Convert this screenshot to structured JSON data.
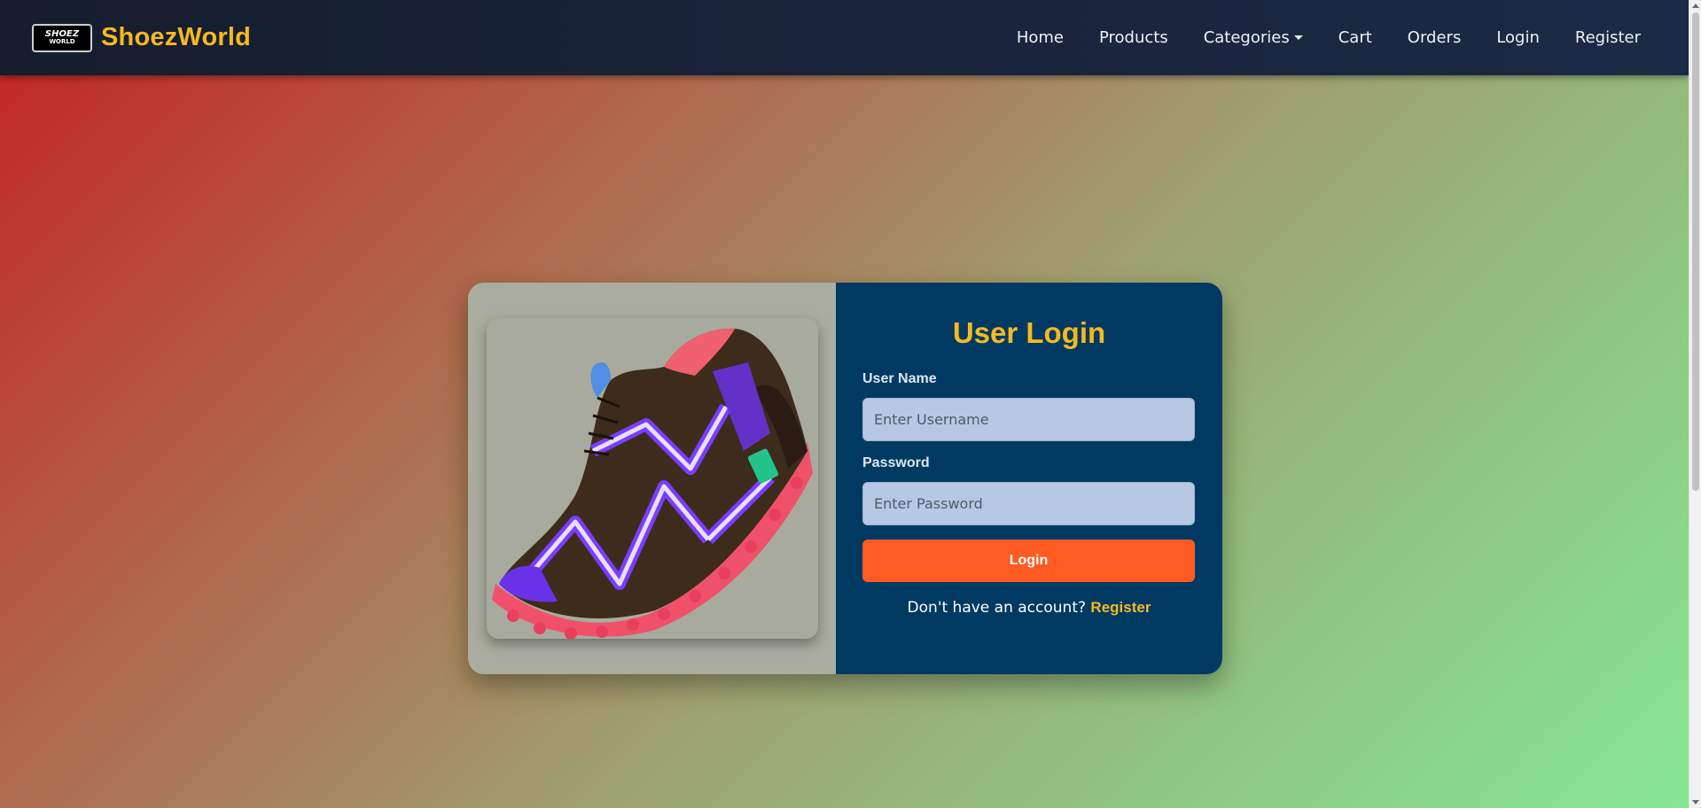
{
  "brand": {
    "logo_line1": "SHOEZ",
    "logo_line2": "WORLD",
    "name": "ShoezWorld"
  },
  "nav": {
    "home": "Home",
    "products": "Products",
    "categories": "Categories",
    "cart": "Cart",
    "orders": "Orders",
    "login": "Login",
    "register": "Register"
  },
  "login_form": {
    "title": "User Login",
    "username_label": "User Name",
    "username_placeholder": "Enter Username",
    "username_value": "",
    "password_label": "Password",
    "password_placeholder": "Enter Password",
    "password_value": "",
    "submit_label": "Login",
    "signup_prompt": "Don't have an account?",
    "signup_link": "Register"
  },
  "colors": {
    "accent": "#f5b921",
    "button": "#ff5a22",
    "panel": "#003a63",
    "navbar": "#1a2438"
  },
  "icons": {
    "dropdown": "caret-down-icon"
  }
}
